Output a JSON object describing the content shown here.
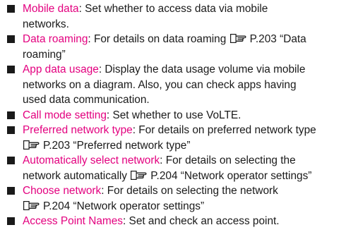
{
  "items": [
    {
      "term": "Mobile data",
      "parts": [
        ": Set whether to access data via mobile",
        "networks."
      ]
    },
    {
      "term": "Data roaming",
      "parts": [
        ": For details on data roaming",
        "P.203 “Data",
        "roaming”"
      ]
    },
    {
      "term": "App data usage",
      "parts": [
        ": Display the data usage volume via mobile",
        "networks on a diagram. Also, you can check apps having",
        "used data communication."
      ]
    },
    {
      "term": "Call mode setting",
      "parts": [
        ": Set whether to use VoLTE."
      ]
    },
    {
      "term": "Preferred network type",
      "parts": [
        ": For details on preferred network type",
        "P.203 “Preferred network type”"
      ]
    },
    {
      "term": "Automatically select network",
      "parts": [
        ": For details on selecting the",
        "network automatically",
        "P.204 “Network operator settings”"
      ]
    },
    {
      "term": "Choose network",
      "parts": [
        ": For details on selecting the network",
        "P.204 “Network operator settings”"
      ]
    },
    {
      "term": "Access Point Names",
      "parts": [
        ": Set and check an access point."
      ]
    }
  ],
  "icons": {
    "reference": "reference-hand-icon"
  },
  "colors": {
    "term": "#e3007f",
    "text": "#1a1a1a"
  }
}
